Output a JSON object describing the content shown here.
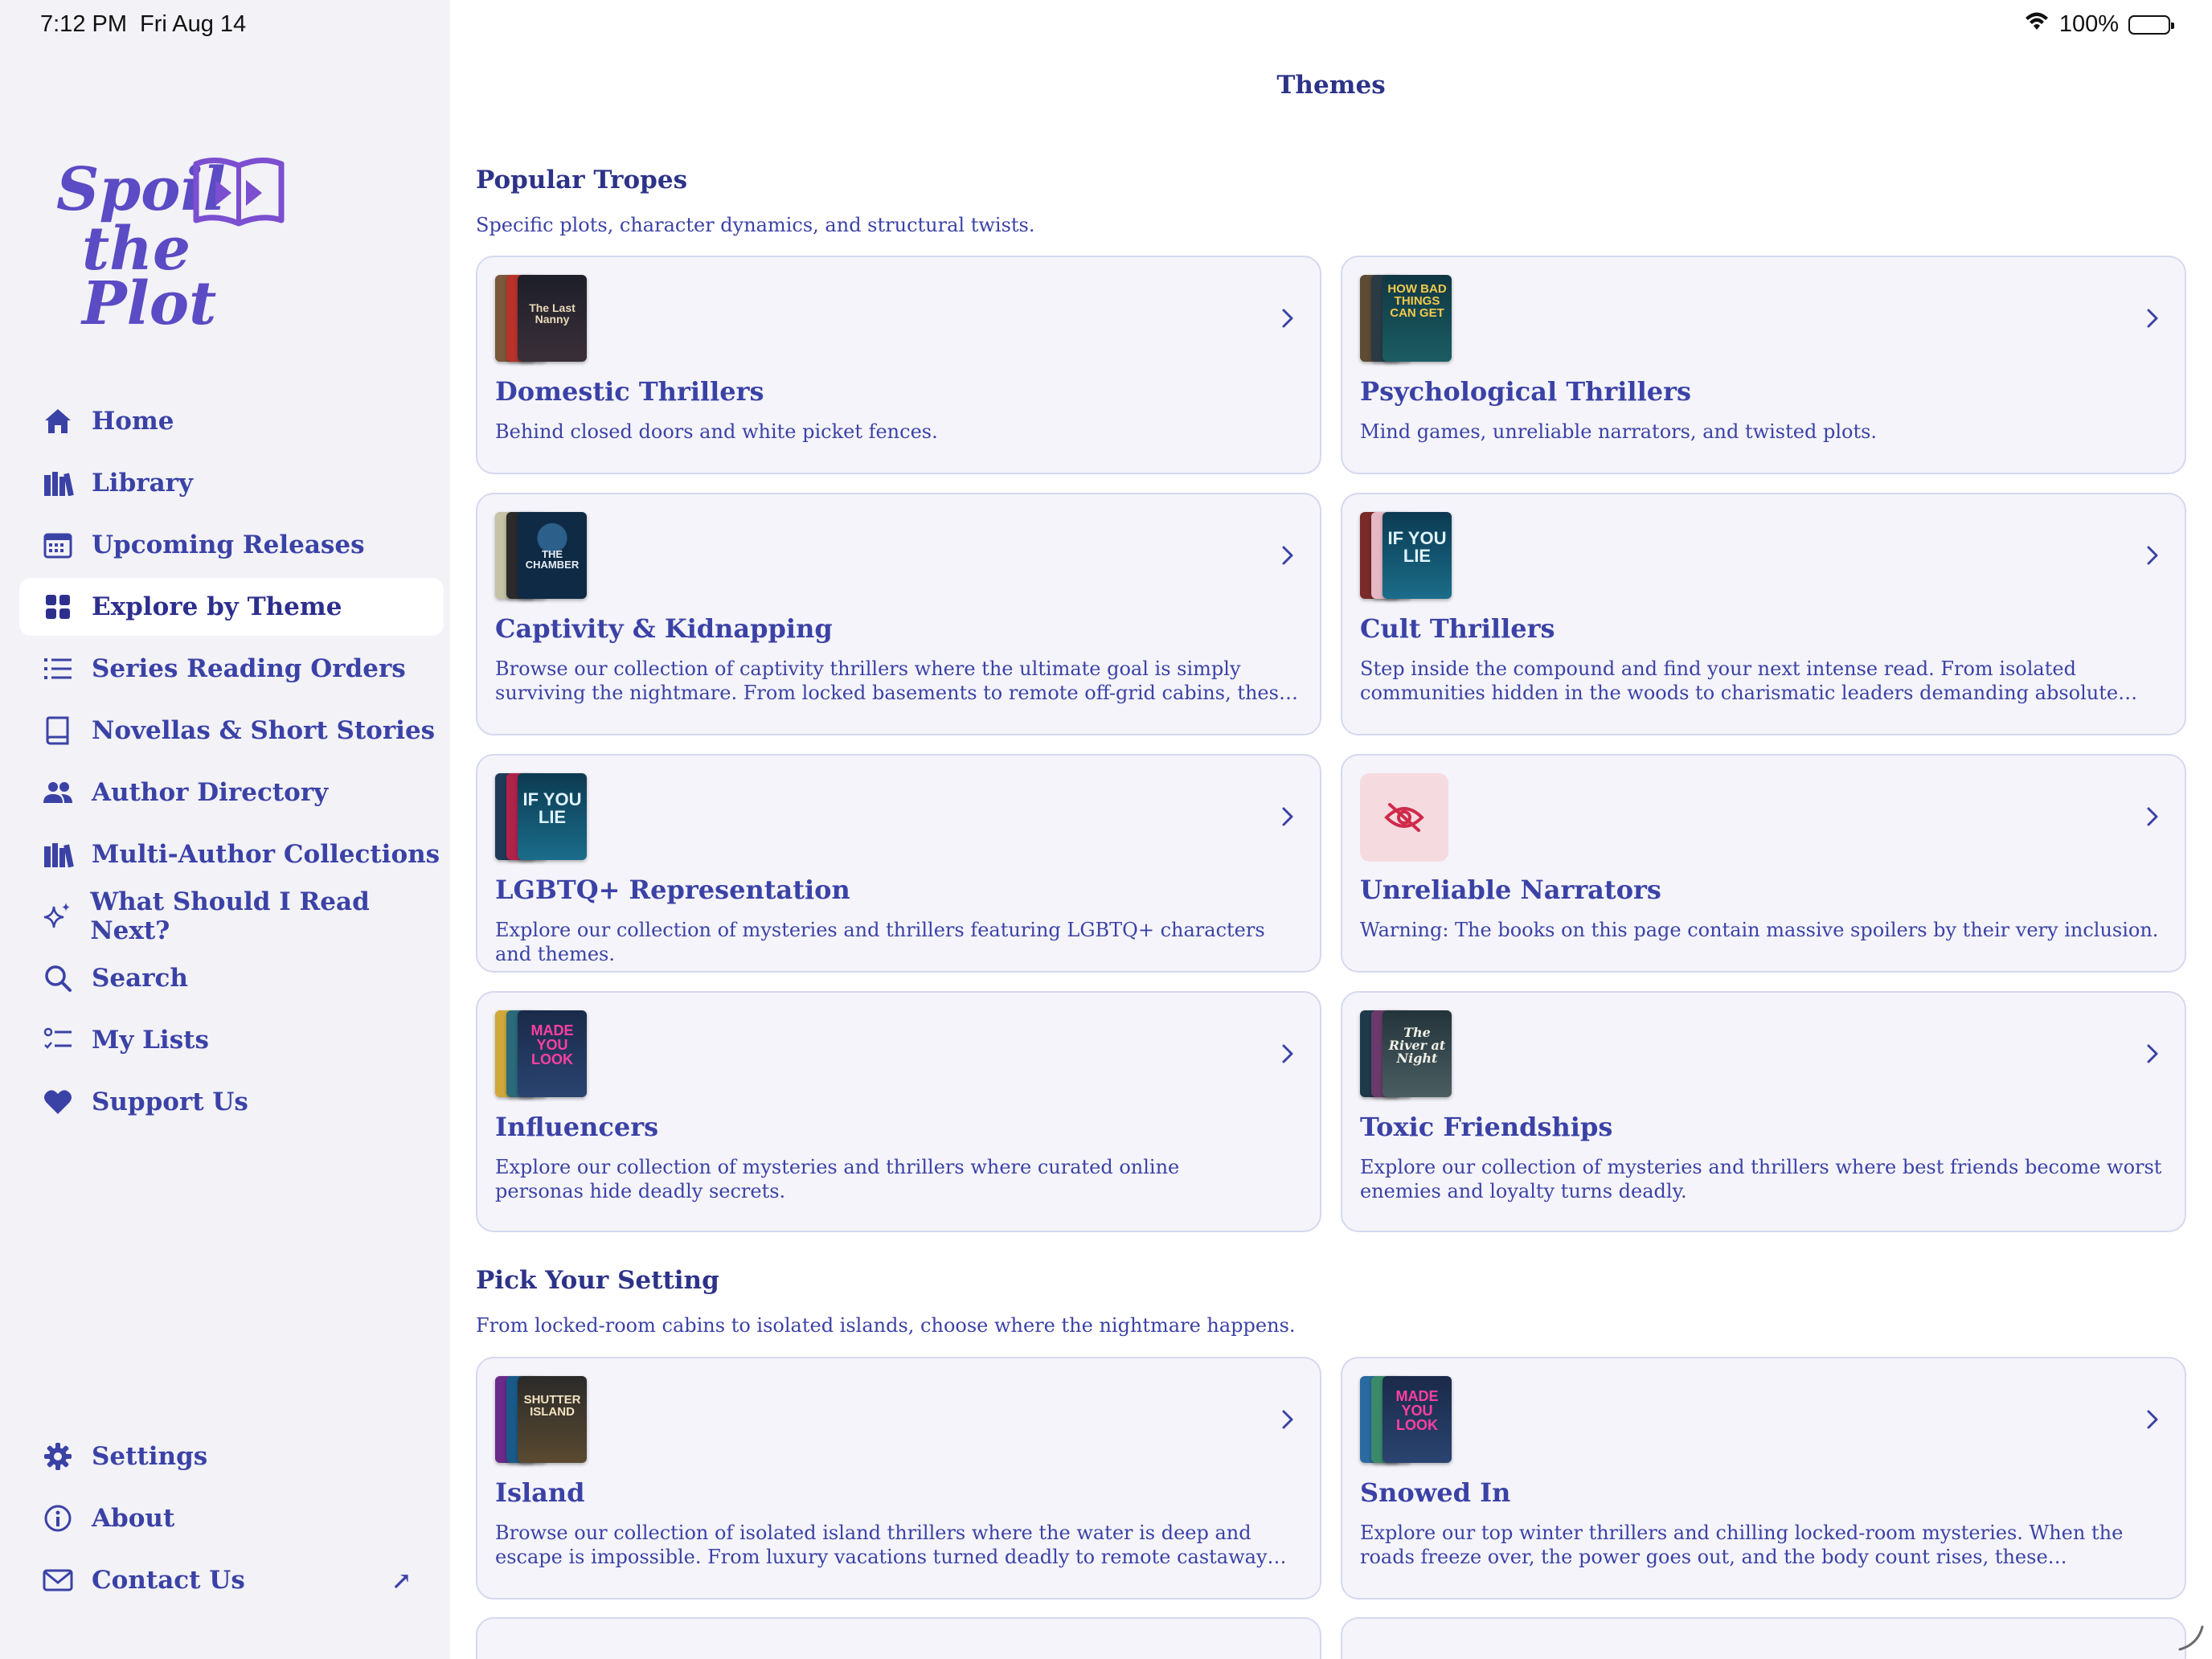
{
  "status": {
    "time": "7:12 PM",
    "date": "Fri Aug 14",
    "battery": "100%"
  },
  "brand": {
    "line1": "Spoil",
    "line2": "the Plot"
  },
  "nav": {
    "items": [
      {
        "label": "Home",
        "icon": "home-icon"
      },
      {
        "label": "Library",
        "icon": "library-icon"
      },
      {
        "label": "Upcoming Releases",
        "icon": "calendar-icon"
      },
      {
        "label": "Explore by Theme",
        "icon": "grid-icon",
        "active": true
      },
      {
        "label": "Series Reading Orders",
        "icon": "list-numbered-icon"
      },
      {
        "label": "Novellas & Short Stories",
        "icon": "book-icon"
      },
      {
        "label": "Author Directory",
        "icon": "people-icon"
      },
      {
        "label": "Multi-Author Collections",
        "icon": "books-icon"
      },
      {
        "label": "What Should I Read Next?",
        "icon": "sparkles-icon"
      },
      {
        "label": "Search",
        "icon": "search-icon"
      },
      {
        "label": "My Lists",
        "icon": "checklist-icon"
      },
      {
        "label": "Support Us",
        "icon": "heart-icon"
      }
    ],
    "bottom": [
      {
        "label": "Settings",
        "icon": "gear-icon"
      },
      {
        "label": "About",
        "icon": "info-icon"
      },
      {
        "label": "Contact Us",
        "icon": "envelope-icon",
        "external": "↗"
      }
    ]
  },
  "page": {
    "title": "Themes"
  },
  "sections": [
    {
      "title": "Popular Tropes",
      "subtitle": "Specific plots, character dynamics, and structural twists.",
      "cards": [
        {
          "title": "Domestic Thrillers",
          "desc": "Behind closed doors and white picket fences.",
          "cover_text": "The Last Nanny"
        },
        {
          "title": "Psychological Thrillers",
          "desc": "Mind games, unreliable narrators, and twisted plots.",
          "cover_text": "HOW BAD THINGS CAN GET"
        },
        {
          "title": "Captivity & Kidnapping",
          "desc": "Browse our collection of captivity thrillers where the ultimate goal is simply surviving the nightmare. From locked basements to remote off-grid cabins, these gripping books follow cha...",
          "cover_text": "THE CHAMBER"
        },
        {
          "title": "Cult Thrillers",
          "desc": "Step inside the compound and find your next intense read. From isolated communities hidden in the woods to charismatic leaders demanding absolute loyalty, explore these gripping thrill...",
          "cover_text": "IF YOU LIE"
        },
        {
          "title": "LGBTQ+ Representation",
          "desc": "Explore our collection of mysteries and thrillers featuring LGBTQ+ characters and themes.",
          "cover_text": "IF YOU LIE"
        },
        {
          "title": "Unreliable Narrators",
          "desc": "Warning: The books on this page contain massive spoilers by their very inclusion.",
          "icon": "eye-slash-icon"
        },
        {
          "title": "Influencers",
          "desc": "Explore our collection of mysteries and thrillers where curated online personas hide deadly secrets.",
          "cover_text": "MADE YOU LOOK"
        },
        {
          "title": "Toxic Friendships",
          "desc": "Explore our collection of mysteries and thrillers where best friends become worst enemies and loyalty turns deadly.",
          "cover_text": "The River at Night"
        }
      ]
    },
    {
      "title": "Pick Your Setting",
      "subtitle": "From locked-room cabins to isolated islands, choose where the nightmare happens.",
      "cards": [
        {
          "title": "Island",
          "desc": "Browse our collection of isolated island thrillers where the water is deep and escape is impossible. From luxury vacations turned deadly to remote castaway mysteries, these locked-...",
          "cover_text": "SHUTTER ISLAND"
        },
        {
          "title": "Snowed In",
          "desc": "Explore our top winter thrillers and chilling locked-room mysteries. When the roads freeze over, the power goes out, and the body count rises, these atmospheric books turn a cozy snow...",
          "cover_text": "MADE YOU LOOK"
        }
      ]
    }
  ],
  "colors": {
    "accent": "#3b42a6",
    "sidebar_bg": "#f2f2f7",
    "card_bg": "#f4f4fa",
    "card_border": "#d6d8ef"
  }
}
